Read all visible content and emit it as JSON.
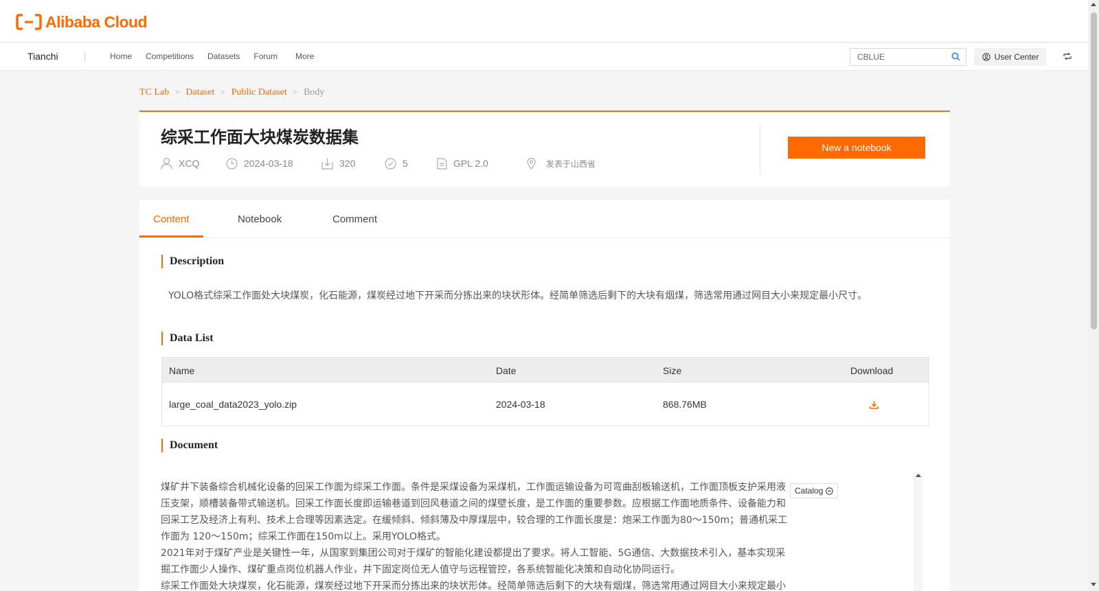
{
  "brand": {
    "logo_text": "Alibaba Cloud",
    "accent": "#ff6a00"
  },
  "nav": {
    "brand": "Tianchi",
    "items": [
      "Home",
      "Competitions",
      "Datasets",
      "Forum",
      "More"
    ],
    "search_value": "CBLUE",
    "user_center": "User Center"
  },
  "breadcrumb": [
    "TC Lab",
    "Dataset",
    "Public Dataset",
    "Body"
  ],
  "dataset": {
    "title": "综采工作面大块煤炭数据集",
    "author": "XCQ",
    "date": "2024-03-18",
    "downloads": "320",
    "likes": "5",
    "license": "GPL 2.0",
    "location": "发表于山西省",
    "new_notebook_label": "New a notebook"
  },
  "tabs": [
    "Content",
    "Notebook",
    "Comment"
  ],
  "description": {
    "title": "Description",
    "text": "YOLO格式综采工作面处大块煤炭，化石能源，煤炭经过地下开采而分拣出来的块状形体。经简单筛选后剩下的大块有烟煤，筛选常用通过网目大小来规定最小尺寸。"
  },
  "data_list": {
    "title": "Data List",
    "columns": [
      "Name",
      "Date",
      "Size",
      "Download"
    ],
    "rows": [
      {
        "name": "large_coal_data2023_yolo.zip",
        "date": "2024-03-18",
        "size": "868.76MB"
      }
    ]
  },
  "document": {
    "title": "Document",
    "catalog_label": "Catalog",
    "lines": [
      "煤矿井下装备综合机械化设备的回采工作面为综采工作面。条件是采煤设备为采煤机，工作面运输设备为可弯曲刮板输送机，工作面顶板支护采用液",
      "压支架，顺槽装备带式输送机。回采工作面长度即运输巷道到回风巷道之间的煤壁长度，是工作面的重要参数。应根据工作面地质条件、设备能力和",
      "回采工艺及经济上有利、技术上合理等因素选定。在缓倾斜、倾斜薄及中厚煤层中，较合理的工作面长度是：炮采工作面为80～150m；普通机采工",
      "作面为 120～150m；综采工作面在150m以上。采用YOLO格式。",
      "2021年对于煤矿产业是关键性一年，从国家到集团公司对于煤矿的智能化建设都提出了要求。将人工智能、5G通信、大数据技术引入，基本实现采",
      "掘工作面少人操作、煤矿重点岗位机器人作业，井下固定岗位无人值守与远程管控，各系统智能化决策和自动化协同运行。",
      "综采工作面处大块煤炭，化石能源，煤炭经过地下开采而分拣出来的块状形体。经简单筛选后剩下的大块有烟煤，筛选常用通过网目大小来规定最小"
    ]
  }
}
